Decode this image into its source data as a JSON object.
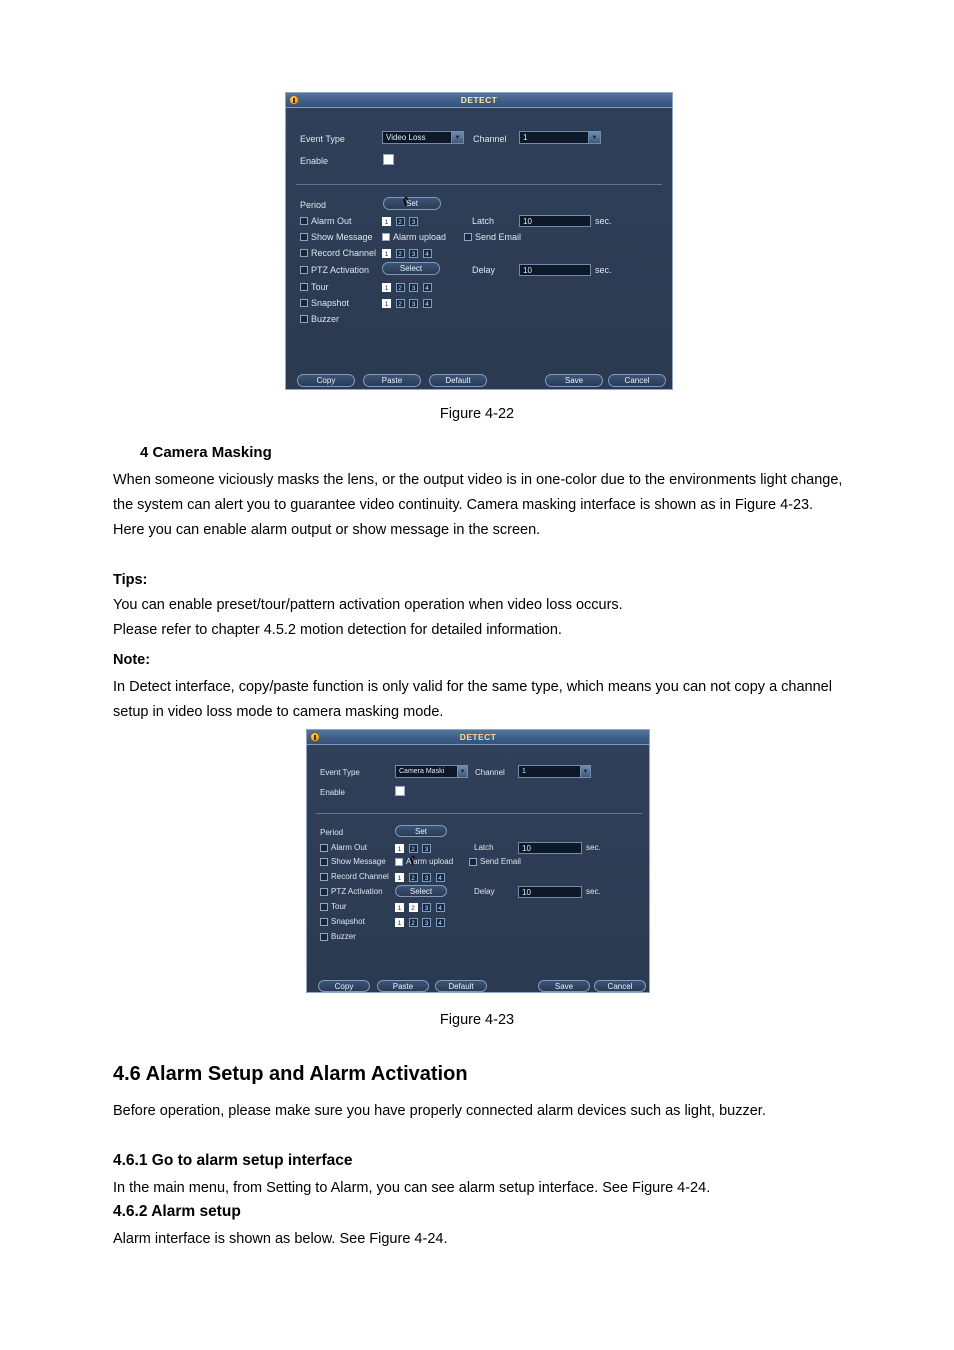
{
  "document": {
    "figure_22_caption": "Figure 4-22",
    "figure_23_caption": "Figure 4-23",
    "section_heading_camera_masking": "4 Camera Masking",
    "paragraph_camera_masking": "When someone viciously masks the lens, or the output video is in one-color due to the environments light change, the system can alert you to guarantee video continuity. Camera masking interface is shown as in Figure 4-23. Here you can enable alarm output or show message in the screen.",
    "tips_label": "Tips:",
    "tips_line1": "You can enable preset/tour/pattern activation operation when video loss occurs.",
    "tips_line2": "Please refer to chapter 4.5.2 motion detection for detailed information.",
    "note_label": "Note:",
    "note_text": "In Detect interface, copy/paste function is only valid for the same type, which means you can not copy a channel setup in video loss mode to camera masking mode.",
    "section_46_title": "4.6  Alarm Setup and Alarm Activation",
    "section_46_paragraph": "Before operation, please make sure you have properly connected alarm devices such as light, buzzer.",
    "section_461_title": "4.6.1  Go to alarm setup interface",
    "section_461_paragraph": "In the main menu, from Setting to Alarm, you can see alarm setup interface. See Figure 4-24.",
    "section_462_title": "4.6.2  Alarm setup",
    "section_462_paragraph": "Alarm interface is shown as below. See Figure 4-24."
  },
  "dialog_fig22": {
    "title": "DETECT",
    "event_type_label": "Event Type",
    "event_type_value": "Video Loss",
    "channel_label": "Channel",
    "channel_value": "1",
    "enable_label": "Enable",
    "period_label": "Period",
    "period_button": "Set",
    "alarm_out_label": "Alarm Out",
    "alarm_out_channels": [
      "1",
      "2",
      "3"
    ],
    "alarm_out_selected": [
      "1"
    ],
    "latch_label": "Latch",
    "latch_value": "10",
    "latch_unit": "sec.",
    "show_message_label": "Show Message",
    "alarm_upload_label": "Alarm upload",
    "send_email_label": "Send Email",
    "record_channel_label": "Record Channel",
    "record_channels": [
      "1",
      "2",
      "3",
      "4"
    ],
    "record_channels_selected": [
      "1"
    ],
    "ptz_activation_label": "PTZ Activation",
    "ptz_button": "Select",
    "delay_label": "Delay",
    "delay_value": "10",
    "delay_unit": "sec.",
    "tour_label": "Tour",
    "tour_channels": [
      "1",
      "2",
      "3",
      "4"
    ],
    "tour_channels_selected": [
      "1"
    ],
    "snapshot_label": "Snapshot",
    "snapshot_channels": [
      "1",
      "2",
      "3",
      "4"
    ],
    "snapshot_channels_selected": [
      "1"
    ],
    "buzzer_label": "Buzzer",
    "copy_button": "Copy",
    "paste_button": "Paste",
    "default_button": "Default",
    "save_button": "Save",
    "cancel_button": "Cancel"
  },
  "dialog_fig23": {
    "title": "DETECT",
    "event_type_label": "Event Type",
    "event_type_value": "Camera Maski",
    "channel_label": "Channel",
    "channel_value": "1",
    "enable_label": "Enable",
    "period_label": "Period",
    "period_button": "Set",
    "alarm_out_label": "Alarm Out",
    "alarm_out_channels": [
      "1",
      "2",
      "3"
    ],
    "alarm_out_selected": [
      "1"
    ],
    "latch_label": "Latch",
    "latch_value": "10",
    "latch_unit": "sec.",
    "show_message_label": "Show Message",
    "alarm_upload_label": "Alarm upload",
    "send_email_label": "Send Email",
    "record_channel_label": "Record Channel",
    "record_channels": [
      "1",
      "2",
      "3",
      "4"
    ],
    "record_channels_selected": [
      "1"
    ],
    "ptz_activation_label": "PTZ Activation",
    "ptz_button": "Select",
    "delay_label": "Delay",
    "delay_value": "10",
    "delay_unit": "sec.",
    "tour_label": "Tour",
    "tour_channels": [
      "1",
      "2",
      "3",
      "4"
    ],
    "tour_channels_selected": [
      "1",
      "2"
    ],
    "snapshot_label": "Snapshot",
    "snapshot_channels": [
      "1",
      "2",
      "3",
      "4"
    ],
    "snapshot_channels_selected": [
      "1"
    ],
    "buzzer_label": "Buzzer",
    "copy_button": "Copy",
    "paste_button": "Paste",
    "default_button": "Default",
    "save_button": "Save",
    "cancel_button": "Cancel"
  }
}
